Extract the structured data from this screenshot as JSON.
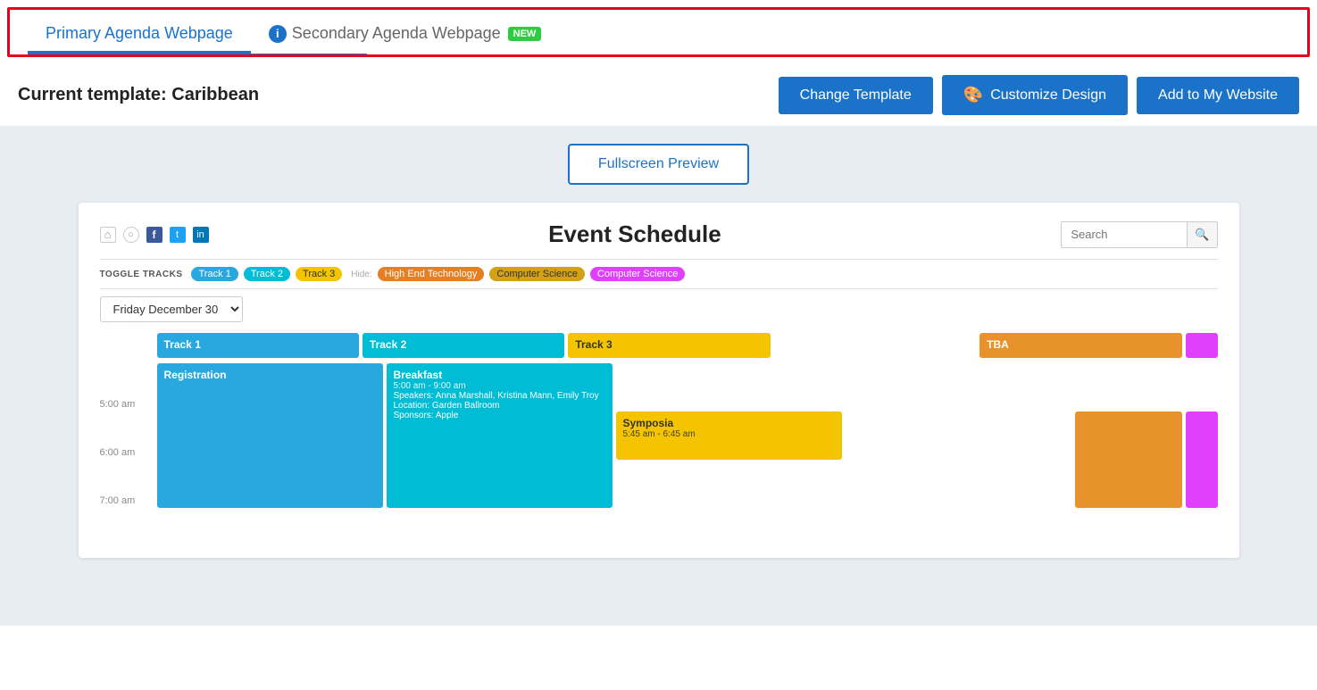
{
  "tabs": {
    "primary": {
      "label": "Primary Agenda Webpage",
      "active": true
    },
    "secondary": {
      "label": "Secondary Agenda Webpage",
      "badge": "NEW",
      "active": false
    }
  },
  "toolbar": {
    "current_template_label": "Current template: Caribbean",
    "change_template_btn": "Change Template",
    "customize_design_btn": "Customize Design",
    "add_to_website_btn": "Add to My Website"
  },
  "preview": {
    "fullscreen_btn": "Fullscreen Preview"
  },
  "schedule": {
    "title": "Event Schedule",
    "search_placeholder": "Search",
    "toggle_tracks_label": "TOGGLE TRACKS",
    "hide_label": "Hide:",
    "tracks": [
      {
        "name": "Track 1",
        "color": "#29a8e0"
      },
      {
        "name": "Track 2",
        "color": "#00bcd4"
      },
      {
        "name": "Track 3",
        "color": "#f5c400"
      },
      {
        "name": "High End Technology",
        "color": "#ff8c00"
      },
      {
        "name": "Computer Science",
        "color": "#e67e22"
      },
      {
        "name": "Computer Science",
        "color": "#e040fb"
      }
    ],
    "date_selector": "Friday December 30",
    "time_slots": [
      "5:00 am",
      "6:00 am",
      "7:00 am"
    ],
    "column_headers": [
      {
        "label": "Track 1",
        "color": "blue"
      },
      {
        "label": "Track 2",
        "color": "teal"
      },
      {
        "label": "Track 3",
        "color": "yellow"
      },
      {
        "label": "",
        "color": "empty"
      },
      {
        "label": "TBA",
        "color": "orange"
      },
      {
        "label": "",
        "color": "pink"
      }
    ],
    "sessions": [
      {
        "col": 0,
        "title": "Registration",
        "color": "blue",
        "tall": true
      },
      {
        "col": 1,
        "title": "Breakfast",
        "time": "5:00 am - 9:00 am",
        "speakers": "Speakers: Anna Marshall, Kristina Mann, Emily Troy",
        "location": "Location: Garden Ballroom",
        "sponsor": "Sponsors: Apple",
        "color": "teal",
        "tall": true
      },
      {
        "col": 2,
        "title": "Symposia",
        "time": "5:45 am - 6:45 am",
        "color": "yellow"
      },
      {
        "col": 4,
        "color": "orange",
        "tall": true
      },
      {
        "col": 5,
        "color": "pink",
        "tall": true
      }
    ]
  }
}
